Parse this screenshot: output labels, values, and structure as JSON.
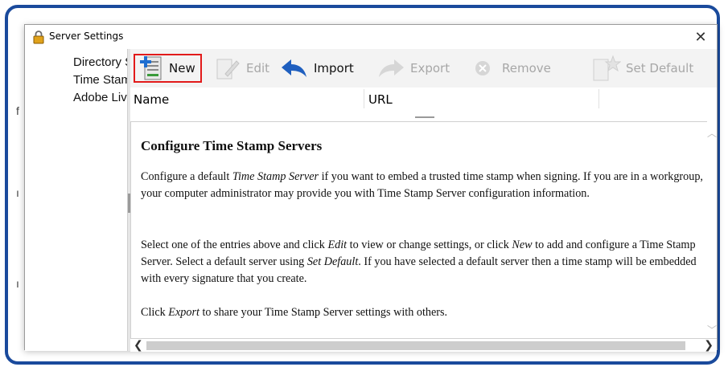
{
  "dialog": {
    "title": "Server Settings",
    "close_glyph": "✕"
  },
  "sidebar": {
    "items": [
      {
        "label": "Directory Servers"
      },
      {
        "label": "Time Stamp Servers"
      },
      {
        "label": "Adobe LiveCycle Rights Management"
      }
    ]
  },
  "toolbar": {
    "new_label": "New",
    "edit_label": "Edit",
    "import_label": "Import",
    "export_label": "Export",
    "remove_label": "Remove",
    "set_default_label": "Set Default"
  },
  "list": {
    "columns": [
      "Name",
      "URL"
    ]
  },
  "info": {
    "title": "Configure Time Stamp Servers",
    "p1_a": "Configure a default ",
    "p1_em": "Time Stamp Server",
    "p1_b": " if you want to embed a trusted time stamp when signing. If you are in a workgroup, your computer administrator may provide you with Time Stamp Server configuration information.",
    "p2_a": "Select one of the entries above and click ",
    "p2_em1": "Edit",
    "p2_b": " to view or change settings, or click ",
    "p2_em2": "New",
    "p2_c": " to add and configure a Time Stamp Server. Select a default server using ",
    "p2_em3": "Set Default",
    "p2_d": ". If you have selected a default server then a time stamp will be embedded with every signature that you create.",
    "p3_a": "Click ",
    "p3_em": "Export",
    "p3_b": " to share your Time Stamp Server settings with others."
  },
  "colors": {
    "frame": "#1a4a9c",
    "highlight": "#e21a1a"
  },
  "icons": [
    "lock-icon",
    "new-server-icon",
    "edit-icon",
    "import-arrow-icon",
    "export-arrow-icon",
    "remove-icon",
    "set-default-icon"
  ]
}
